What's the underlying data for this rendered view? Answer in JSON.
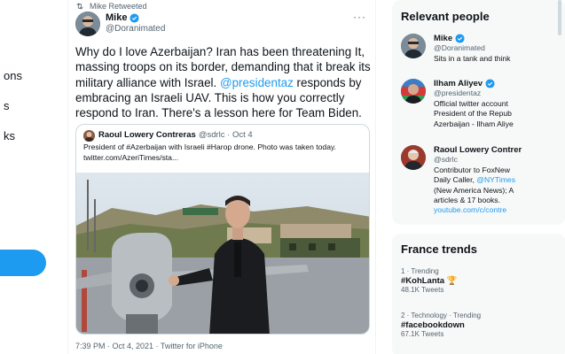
{
  "left_nav": {
    "fragments": [
      "ons",
      "s",
      "ks"
    ]
  },
  "tweet": {
    "retweet_label": "Mike Retweeted",
    "author_name": "Mike",
    "author_handle": "@Doranimated",
    "more_label": "···",
    "text_before_mention": "Why do I love Azerbaijan? Iran has been threatening It, massing troops on its border, demanding that it break its military alliance with Israel. ",
    "mention": "@presidentaz",
    "text_after_mention": " responds by embracing an Israeli UAV. This is how you correctly respond to Iran. There's a lesson here for Team Biden.",
    "timestamp": "7:39 PM · Oct 4, 2021 · Twitter for iPhone"
  },
  "quote": {
    "author_name": "Raoul Lowery Contreras",
    "author_meta": "@sdrlc · Oct 4",
    "text": "President of #Azerbaijan with Israeli #Harop drone. Photo was taken today. twitter.com/AzeriTimes/sta..."
  },
  "relevant_people": {
    "title": "Relevant people",
    "people": [
      {
        "name": "Mike",
        "handle": "@Doranimated",
        "bio": [
          "Sits in a tank and think"
        ]
      },
      {
        "name": "Ilham Aliyev",
        "handle": "@presidentaz",
        "bio": [
          "Official twitter account",
          "President of the Repub",
          "Azerbaijan - Ilham Aliye"
        ]
      },
      {
        "name": "Raoul Lowery Contrer",
        "handle": "@sdrlc",
        "bio_lines": [
          {
            "pre": "Contributor to FoxNew",
            "link": "",
            "post": ""
          },
          {
            "pre": "Daily Caller, ",
            "link": "@NYTimes",
            "post": ""
          },
          {
            "pre": "(New America News); A",
            "link": "",
            "post": ""
          },
          {
            "pre": "articles & 17 books.",
            "link": "",
            "post": ""
          },
          {
            "pre": "",
            "link": "youtube.com/c/contre",
            "post": ""
          }
        ]
      }
    ]
  },
  "trends": {
    "title": "France trends",
    "items": [
      {
        "meta": "1 · Trending",
        "name": "#KohLanta",
        "count": "48.1K Tweets"
      },
      {
        "meta": "2 · Technology · Trending",
        "name": "#facebookdown",
        "count": "67.1K Tweets"
      }
    ]
  },
  "colors": {
    "accent": "#1d9bf0",
    "secondary_text": "#536471"
  }
}
